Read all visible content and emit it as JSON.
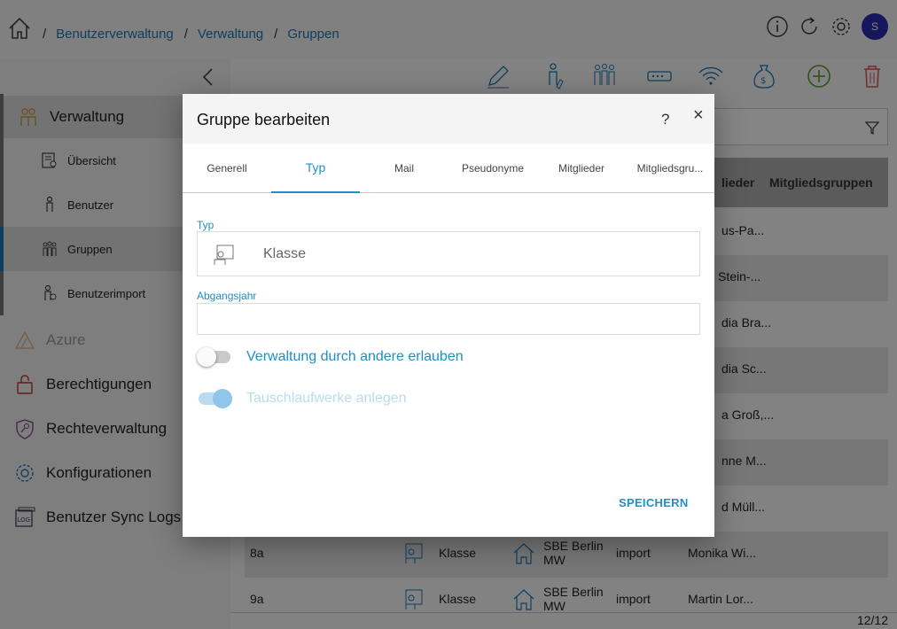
{
  "breadcrumb": [
    "Benutzerverwaltung",
    "Verwaltung",
    "Gruppen"
  ],
  "breadcrumb_separator": "/",
  "user": {
    "avatar_initial": "S",
    "avatar_color": "#2b2bb0"
  },
  "sidebar": {
    "sections": [
      {
        "label": "Verwaltung",
        "icon": "people-icon"
      },
      {
        "label": "Azure",
        "icon": "azure-icon"
      },
      {
        "label": "Berechtigungen",
        "icon": "lock-icon"
      },
      {
        "label": "Rechteverwaltung",
        "icon": "shield-key-icon"
      },
      {
        "label": "Konfigurationen",
        "icon": "gear-people-icon"
      },
      {
        "label": "Benutzer Sync Logs",
        "icon": "log-icon"
      }
    ],
    "subitems": [
      {
        "label": "Übersicht",
        "icon": "overview-icon"
      },
      {
        "label": "Benutzer",
        "icon": "user-icon"
      },
      {
        "label": "Gruppen",
        "icon": "group-icon"
      },
      {
        "label": "Benutzerimport",
        "icon": "user-import-icon"
      }
    ]
  },
  "table": {
    "headers": [
      "lieder",
      "Mitgliedsgruppen"
    ],
    "visible_cells": [
      "us-Pa...",
      "Stein-...",
      "dia Bra...",
      "dia Sc...",
      "a Groß,...",
      "nne M...",
      "d Müll..."
    ],
    "rows": [
      {
        "name": "8a",
        "type": "Klasse",
        "location_line1": "SBE Berlin",
        "location_line2": "MW",
        "source": "import",
        "members": "Monika Wi..."
      },
      {
        "name": "9a",
        "type": "Klasse",
        "location_line1": "SBE Berlin",
        "location_line2": "MW",
        "source": "import",
        "members": "Martin Lor..."
      }
    ],
    "pager": "12/12"
  },
  "dialog": {
    "title": "Gruppe bearbeiten",
    "help": "?",
    "close": "×",
    "tabs": [
      "Generell",
      "Typ",
      "Mail",
      "Pseudonyme",
      "Mitglieder",
      "Mitgliedsgru..."
    ],
    "active_tab": "Typ",
    "typ_label": "Typ",
    "typ_value": "Klasse",
    "abgangsjahr_label": "Abgangsjahr",
    "abgangsjahr_value": "",
    "toggle_verwaltung": {
      "label": "Verwaltung durch andere erlauben",
      "on": false
    },
    "toggle_tausch": {
      "label": "Tauschlaufwerke anlegen",
      "on": true,
      "disabled": true
    },
    "save_label": "SPEICHERN"
  },
  "colors": {
    "accent": "#1f8fc4",
    "link": "#1f78b4",
    "add_green": "#5a9e2f",
    "delete_red": "#d9534f"
  }
}
